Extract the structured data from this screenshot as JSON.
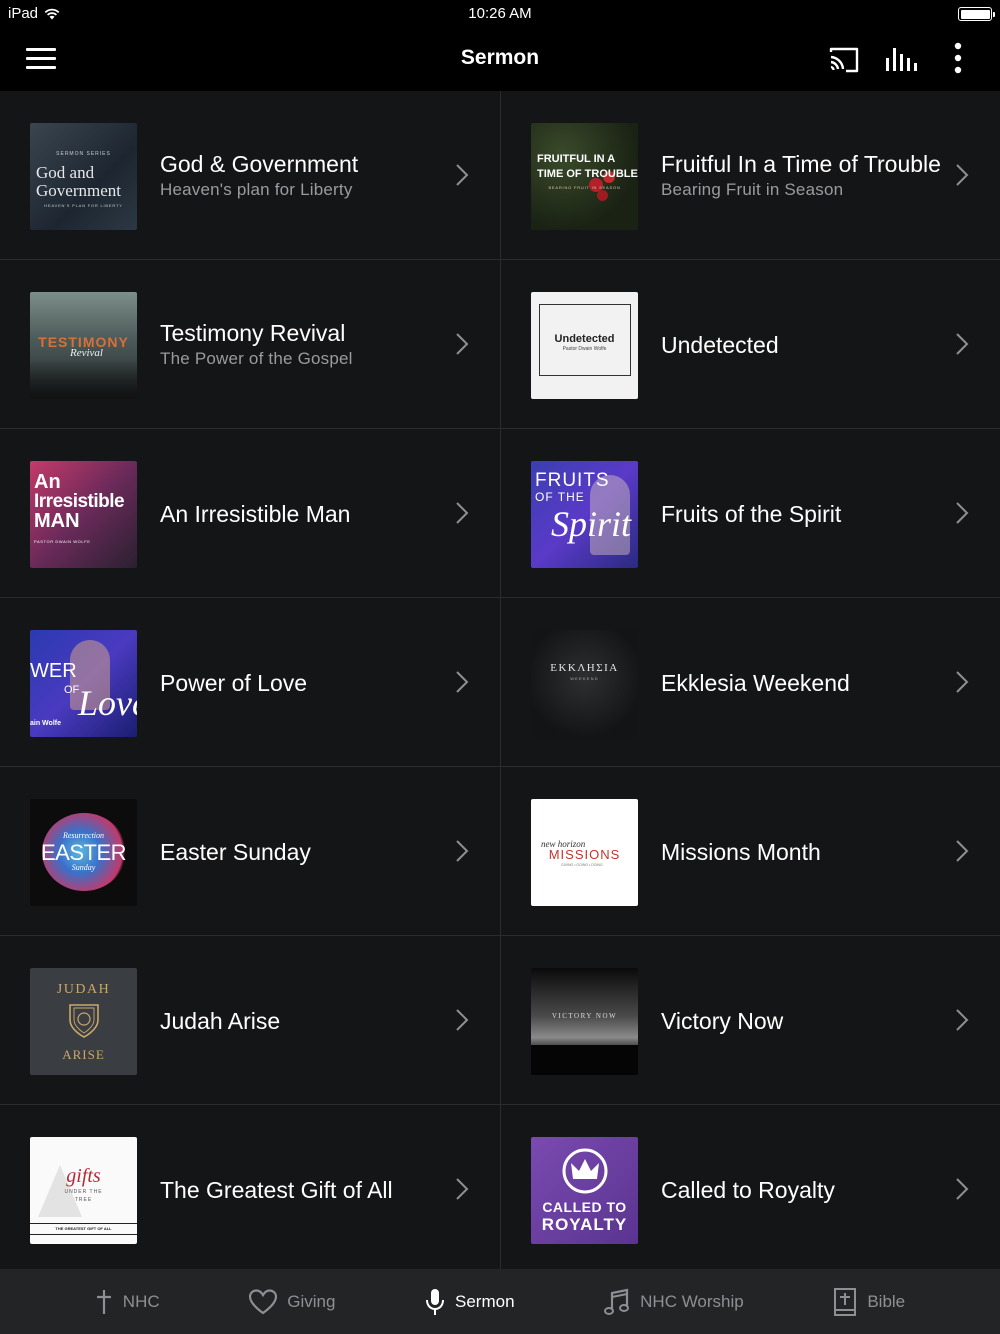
{
  "status_bar": {
    "device": "iPad",
    "time": "10:26 AM"
  },
  "nav": {
    "title": "Sermon",
    "icons": [
      "menu-icon",
      "cast-icon",
      "equalizer-icon",
      "more-vertical-icon"
    ]
  },
  "thumbnails": {
    "god_gov": {
      "series": "SERMON SERIES",
      "line1": "God and",
      "line2": "Government",
      "tagline": "HEAVEN'S PLAN FOR LIBERTY"
    },
    "fruitful": {
      "line1": "FRUITFUL IN A",
      "line2": "TIME OF TROUBLE",
      "tagline": "BEARING FRUIT IN SEASON"
    },
    "testimony": {
      "line1": "TESTIMONY",
      "line2": "Revival"
    },
    "undetected": {
      "line1": "Undetected",
      "line2": "Pastor Dwain Wolfe"
    },
    "irresistible": {
      "line1": "An",
      "line2": "Irresistible",
      "line3": "MAN",
      "line4": "PASTOR DWAIN WOLFE"
    },
    "fruits": {
      "line1": "FRUITS",
      "line2": "OF THE",
      "line3": "Spirit"
    },
    "power": {
      "line1": "WER",
      "line2": "OF",
      "line3": "Love",
      "line4": "ain Wolfe"
    },
    "ekklesia": {
      "line1": "ΕΚΚΛΗΣΙΑ",
      "line2": "WEEKEND"
    },
    "easter": {
      "line1": "Resurrection",
      "line2": "EASTER",
      "line3": "Sunday"
    },
    "missions": {
      "line1": "new horizon",
      "line2": "MISSIONS",
      "line3": "GIVING • GOING • DOING"
    },
    "judah": {
      "line1": "JUDAH",
      "line2": "ARISE"
    },
    "victory": {
      "line1": "VICTORY NOW"
    },
    "gifts": {
      "line1": "gifts",
      "line2": "UNDER THE",
      "line3": "TREE",
      "line4": "THE GREATEST GIFT OF ALL"
    },
    "royalty": {
      "line1": "CALLED TO",
      "line2": "ROYALTY"
    }
  },
  "sermons": [
    {
      "title": "God & Government",
      "subtitle": "Heaven's plan for Liberty"
    },
    {
      "title": "Fruitful In a Time of Trouble",
      "subtitle": "Bearing Fruit in Season"
    },
    {
      "title": "Testimony Revival",
      "subtitle": "The Power of the Gospel"
    },
    {
      "title": "Undetected",
      "subtitle": ""
    },
    {
      "title": "An Irresistible Man",
      "subtitle": ""
    },
    {
      "title": "Fruits of the Spirit",
      "subtitle": ""
    },
    {
      "title": "Power of Love",
      "subtitle": ""
    },
    {
      "title": "Ekklesia Weekend",
      "subtitle": ""
    },
    {
      "title": "Easter Sunday",
      "subtitle": ""
    },
    {
      "title": "Missions Month",
      "subtitle": ""
    },
    {
      "title": "Judah Arise",
      "subtitle": ""
    },
    {
      "title": "Victory Now",
      "subtitle": ""
    },
    {
      "title": "The Greatest Gift of All",
      "subtitle": ""
    },
    {
      "title": "Called to Royalty",
      "subtitle": ""
    }
  ],
  "tabs": [
    {
      "label": "NHC",
      "icon": "cross-icon",
      "active": false
    },
    {
      "label": "Giving",
      "icon": "heart-icon",
      "active": false
    },
    {
      "label": "Sermon",
      "icon": "microphone-icon",
      "active": true
    },
    {
      "label": "NHC Worship",
      "icon": "music-note-icon",
      "active": false
    },
    {
      "label": "Bible",
      "icon": "bible-icon",
      "active": false
    }
  ],
  "colors": {
    "background": "#141517",
    "bar": "#000000",
    "tab_bar": "#232426",
    "subtitle": "#9a9b9e",
    "inactive_tab": "#8e8f92"
  }
}
